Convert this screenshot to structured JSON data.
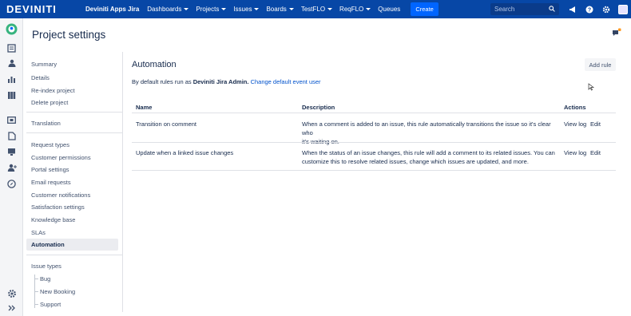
{
  "topbar": {
    "logo": "DEVINITI",
    "app_name": "Deviniti Apps Jira",
    "nav": [
      "Dashboards",
      "Projects",
      "Issues",
      "Boards",
      "TestFLO",
      "ReqFLO",
      "Queues"
    ],
    "create_label": "Create",
    "search_placeholder": "Search"
  },
  "page": {
    "title": "Project settings"
  },
  "sidebar": {
    "group1": [
      "Summary",
      "Details",
      "Re-index project",
      "Delete project"
    ],
    "group2": [
      "Translation"
    ],
    "group3": [
      "Request types",
      "Customer permissions",
      "Portal settings",
      "Email requests",
      "Customer notifications",
      "Satisfaction settings",
      "Knowledge base",
      "SLAs",
      "Automation"
    ],
    "issue_types_label": "Issue types",
    "issue_types": [
      "Bug",
      "New Booking",
      "Support"
    ]
  },
  "main": {
    "title": "Automation",
    "add_rule_label": "Add rule",
    "default_prefix": "By default rules run as",
    "default_user": "Deviniti Jira Admin.",
    "change_link": "Change default event user",
    "columns": {
      "name": "Name",
      "description": "Description",
      "actions": "Actions"
    },
    "rows": [
      {
        "name": "Transition on comment",
        "description_1": "When a comment is added to an issue, this rule automatically transitions the issue so it's clear who",
        "description_2": "it's waiting on.",
        "view_log": "View log",
        "edit": "Edit"
      },
      {
        "name": "Update when a linked issue changes",
        "description_1": "When the status of an issue changes, this rule will add a comment to its related issues. You can",
        "description_2": "customize this to resolve related issues, change which issues are updated, and more.",
        "view_log": "View log",
        "edit": "Edit"
      }
    ]
  },
  "colors": {
    "topbar": "#0747a6",
    "create": "#0065ff",
    "link": "#0052cc"
  }
}
